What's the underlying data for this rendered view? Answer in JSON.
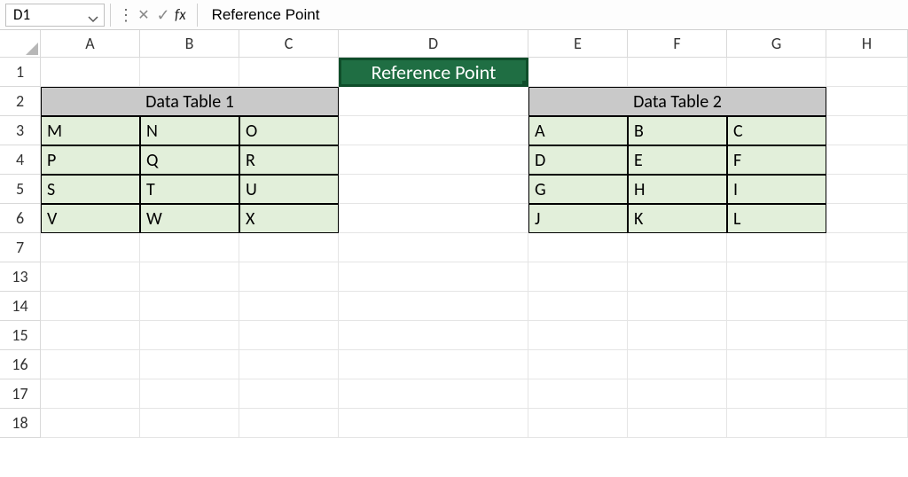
{
  "formula_bar": {
    "name_box": "D1",
    "fx_label": "fx",
    "formula_value": "Reference Point"
  },
  "columns": [
    "A",
    "B",
    "C",
    "D",
    "E",
    "F",
    "G",
    "H"
  ],
  "row_numbers": [
    1,
    2,
    3,
    4,
    5,
    6,
    7,
    13,
    14,
    15,
    16,
    17,
    18
  ],
  "d1_value": "Reference Point",
  "table1": {
    "header": "Data Table 1",
    "rows": [
      [
        "M",
        "N",
        "O"
      ],
      [
        "P",
        "Q",
        "R"
      ],
      [
        "S",
        "T",
        "U"
      ],
      [
        "V",
        "W",
        "X"
      ]
    ]
  },
  "table2": {
    "header": "Data Table 2",
    "rows": [
      [
        "A",
        "B",
        "C"
      ],
      [
        "D",
        "E",
        "F"
      ],
      [
        "G",
        "H",
        "I"
      ],
      [
        "J",
        "K",
        "L"
      ]
    ]
  },
  "chart_data": {
    "type": "table",
    "tables": [
      {
        "name": "Data Table 1",
        "range": "A2:C6",
        "header": "Data Table 1",
        "data": [
          [
            "M",
            "N",
            "O"
          ],
          [
            "P",
            "Q",
            "R"
          ],
          [
            "S",
            "T",
            "U"
          ],
          [
            "V",
            "W",
            "X"
          ]
        ]
      },
      {
        "name": "Data Table 2",
        "range": "E2:G6",
        "header": "Data Table 2",
        "data": [
          [
            "A",
            "B",
            "C"
          ],
          [
            "D",
            "E",
            "F"
          ],
          [
            "G",
            "H",
            "I"
          ],
          [
            "J",
            "K",
            "L"
          ]
        ]
      }
    ],
    "reference_cell": {
      "address": "D1",
      "value": "Reference Point"
    }
  }
}
